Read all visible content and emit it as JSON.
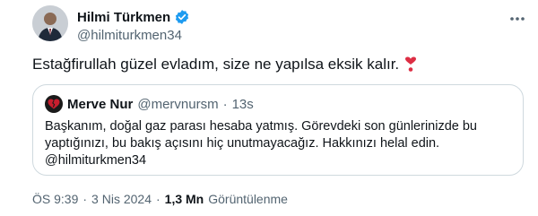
{
  "author": {
    "name": "Hilmi Türkmen",
    "handle": "@hilmiturkmen34",
    "avatar_icon": "profile-photo",
    "verified_color": "#1d9bf0"
  },
  "tweet": {
    "text": "Estağfirullah güzel evladım, size ne yapılsa eksik kalır.",
    "emoji": "red-heart-exclamation",
    "more_icon": "more-horizontal-icon"
  },
  "quote": {
    "name": "Merve Nur",
    "handle": "@mervnursm",
    "separator": "·",
    "time": "13s",
    "avatar_icon": "broken-heart",
    "text": "Başkanım, doğal gaz parası hesaba yatmış. Görevdeki son günlerinizde bu yaptığınızı, bu bakış açısını hiç unutmayacağız. Hakkınızı helal edin. @hilmiturkmen34"
  },
  "meta": {
    "time": "ÖS 9:39",
    "sep1": "·",
    "date": "3 Nis 2024",
    "sep2": "·",
    "views_count": "1,3 Mn",
    "views_label": "Görüntülenme"
  }
}
